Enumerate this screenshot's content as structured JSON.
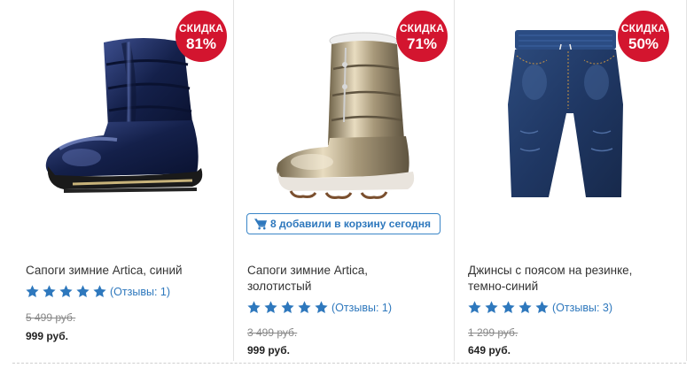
{
  "products": [
    {
      "title": "Сапоги зимние Artica, синий",
      "badge_label": "СКИДКА",
      "discount": "81%",
      "rating_stars": 5,
      "reviews": "(Отзывы: 1)",
      "old_price": "5 499 руб.",
      "price": "999 руб."
    },
    {
      "title_line1": "Сапоги зимние Artica,",
      "title_line2": "золотистый",
      "badge_label": "СКИДКА",
      "discount": "71%",
      "cart_note": "8 добавили в корзину сегодня",
      "rating_stars": 5,
      "reviews": "(Отзывы: 1)",
      "old_price": "3 499 руб.",
      "price": "999 руб."
    },
    {
      "title_line1": "Джинсы с поясом на резинке,",
      "title_line2": "темно-синий",
      "badge_label": "СКИДКА",
      "discount": "50%",
      "rating_stars": 5,
      "reviews": "(Отзывы: 3)",
      "old_price": "1 299 руб.",
      "price": "649 руб."
    }
  ],
  "colors": {
    "badge": "#d3152f",
    "link": "#2e78bd",
    "star": "#2e78bd"
  },
  "icons": [
    "shopping-cart-icon",
    "star-icon"
  ]
}
